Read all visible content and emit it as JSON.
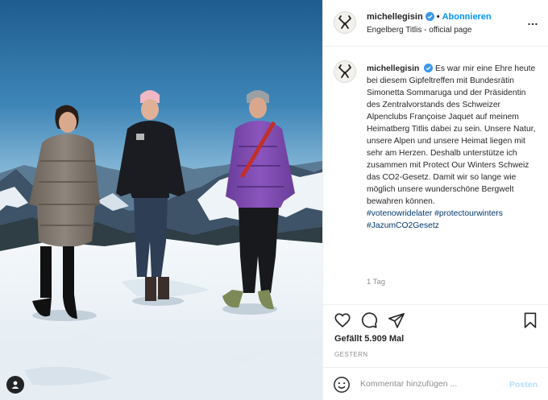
{
  "post": {
    "username": "michellegisin",
    "follow_label": "Abonnieren",
    "location": "Engelberg Titlis - official page",
    "more_icon": "…",
    "caption_text": "Es war mir eine Ehre heute bei diesem Gipfeltreffen mit Bundesrätin Simonetta Sommaruga und der Präsidentin des Zentralvorstands des Schweizer Alpenclubs Françoise Jaquet auf meinem Heimatberg Titlis dabei zu sein. Unsere Natur, unsere Alpen und unsere Heimat liegen mit sehr am Herzen. Deshalb unterstütze ich zusammen mit Protect Our Winters Schweiz das CO2-Gesetz. Damit wir so lange wie möglich unsere wunderschöne Bergwelt bewahren können.",
    "hashtags": "#votenowridelater #protectourwinters #JazumCO2Gesetz",
    "time_ago": "1 Tag",
    "likes": "Gefällt 5.909 Mal",
    "date": "GESTERN",
    "comment_placeholder": "Kommentar hinzufügen ...",
    "post_label": "Posten"
  },
  "icons": {
    "verified": "verified-badge-icon",
    "like": "heart-icon",
    "comment": "comment-icon",
    "share": "send-icon",
    "save": "bookmark-icon",
    "emoji": "emoji-icon",
    "user_tag": "user-icon"
  },
  "colors": {
    "accent": "#0095f6",
    "verified": "#3897f0",
    "secondary_text": "#8e8e8e",
    "hashtag": "#00376b",
    "post_disabled": "#b2dffc"
  }
}
